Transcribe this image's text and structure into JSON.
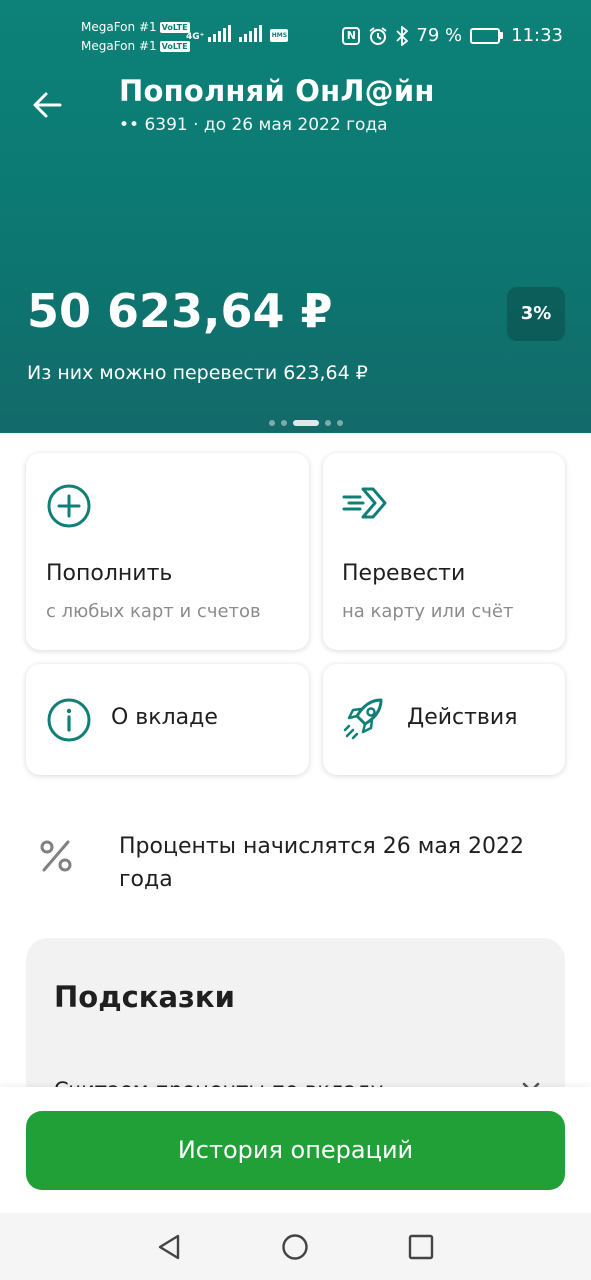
{
  "status_bar": {
    "carrier_1": "MegaFon #1",
    "carrier_2": "MegaFon #1",
    "volte": "VoLTE",
    "network": "4G⁺",
    "hms": "HMS",
    "battery_percent": "79 %",
    "battery_level": 0.79,
    "time": "11:33",
    "icons": [
      "nfc-icon",
      "alarm-icon",
      "bluetooth-icon",
      "battery-icon"
    ]
  },
  "header": {
    "back_icon": "arrow-left-icon",
    "title": "Пополняй ОнЛ@йн",
    "subtitle": "•• 6391 · до 26 мая 2022 года",
    "balance": "50 623,64 ₽",
    "rate": "3%",
    "transferable": "Из них можно перевести 623,64 ₽",
    "pager": {
      "count": 5,
      "active": 2
    }
  },
  "actions": [
    {
      "title": "Пополнить",
      "subtitle": "с любых карт и счетов",
      "icon": "plus-circle-icon"
    },
    {
      "title": "Перевести",
      "subtitle": "на карту или счёт",
      "icon": "send-arrow-icon"
    },
    {
      "title": "О вкладе",
      "icon": "info-circle-icon"
    },
    {
      "title": "Действия",
      "icon": "rocket-icon"
    }
  ],
  "interest_info": {
    "icon": "percent-icon",
    "text": "Проценты начислятся 26 мая 2022 года"
  },
  "hints": {
    "title": "Подсказки",
    "item": "Считаем проценты по вкладу",
    "close_icon": "close-icon"
  },
  "history_button": "История операций",
  "nav_bar": [
    "back-triangle-icon",
    "home-circle-icon",
    "recents-square-icon"
  ],
  "colors": {
    "header_bg": "#0b7a72",
    "accent_green": "#21a038",
    "icon_teal": "#107f77"
  }
}
